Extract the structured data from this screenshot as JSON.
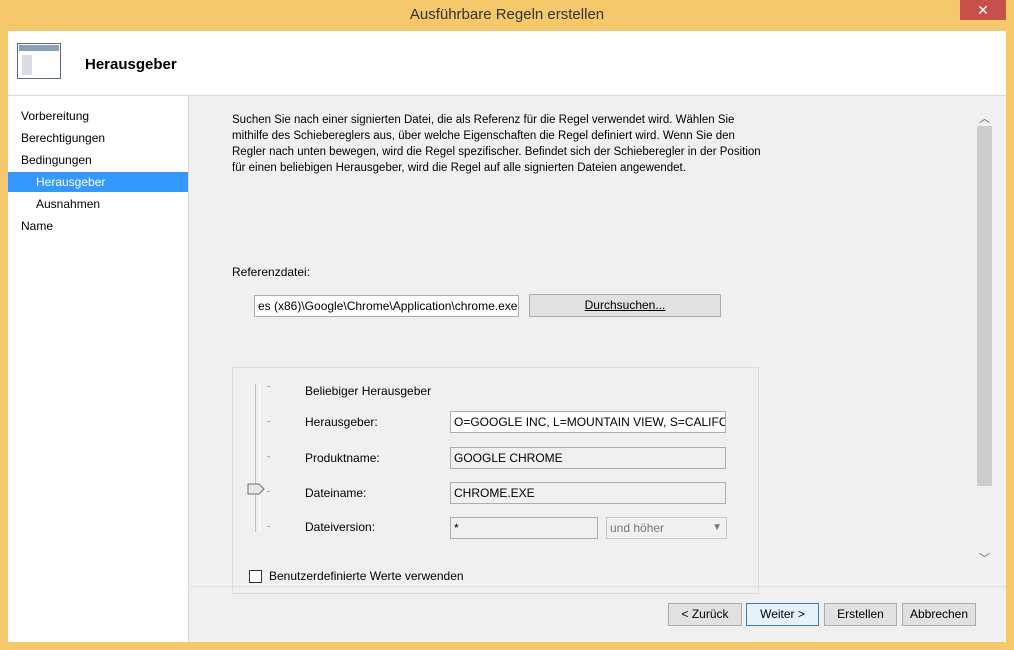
{
  "window": {
    "title": "Ausführbare Regeln erstellen",
    "close_glyph": "✕"
  },
  "header": {
    "title": "Herausgeber",
    "icon": "wizard-window-icon"
  },
  "sidebar": {
    "items": [
      {
        "label": "Vorbereitung",
        "selected": false,
        "sub": false
      },
      {
        "label": "Berechtigungen",
        "selected": false,
        "sub": false
      },
      {
        "label": "Bedingungen",
        "selected": false,
        "sub": false
      },
      {
        "label": "Herausgeber",
        "selected": true,
        "sub": true
      },
      {
        "label": "Ausnahmen",
        "selected": false,
        "sub": true
      },
      {
        "label": "Name",
        "selected": false,
        "sub": false
      }
    ]
  },
  "main": {
    "description": "Suchen Sie nach einer signierten Datei, die als Referenz für die Regel verwendet wird. Wählen Sie mithilfe des Schiebereglers aus, über welche Eigenschaften die Regel definiert wird. Wenn Sie den Regler nach unten bewegen, wird die Regel spezifischer. Befindet sich der Schieberegler in der Position für einen beliebigen Herausgeber, wird die Regel auf alle signierten Dateien angewendet.",
    "reference_label": "Referenzdatei:",
    "reference_value": "es (x86)\\Google\\Chrome\\Application\\chrome.exe",
    "browse_button": "Durchsuchen...",
    "any_publisher_label": "Beliebiger Herausgeber",
    "publisher_label": "Herausgeber:",
    "publisher_value": "O=GOOGLE INC, L=MOUNTAIN VIEW, S=CALIFORNIA",
    "product_label": "Produktname:",
    "product_value": "GOOGLE CHROME",
    "filename_label": "Dateiname:",
    "filename_value": "CHROME.EXE",
    "version_label": "Dateiversion:",
    "version_value": "*",
    "version_mode": "und höher",
    "custom_values_label": "Benutzerdefinierte Werte verwenden",
    "custom_values_checked": false,
    "slider_level": "Dateiname"
  },
  "footer": {
    "back": "< Zurück",
    "next": "Weiter >",
    "create": "Erstellen",
    "cancel": "Abbrechen"
  },
  "colors": {
    "titlebar": "#f5c96b",
    "selection": "#3399ff",
    "close": "#c7504b"
  }
}
